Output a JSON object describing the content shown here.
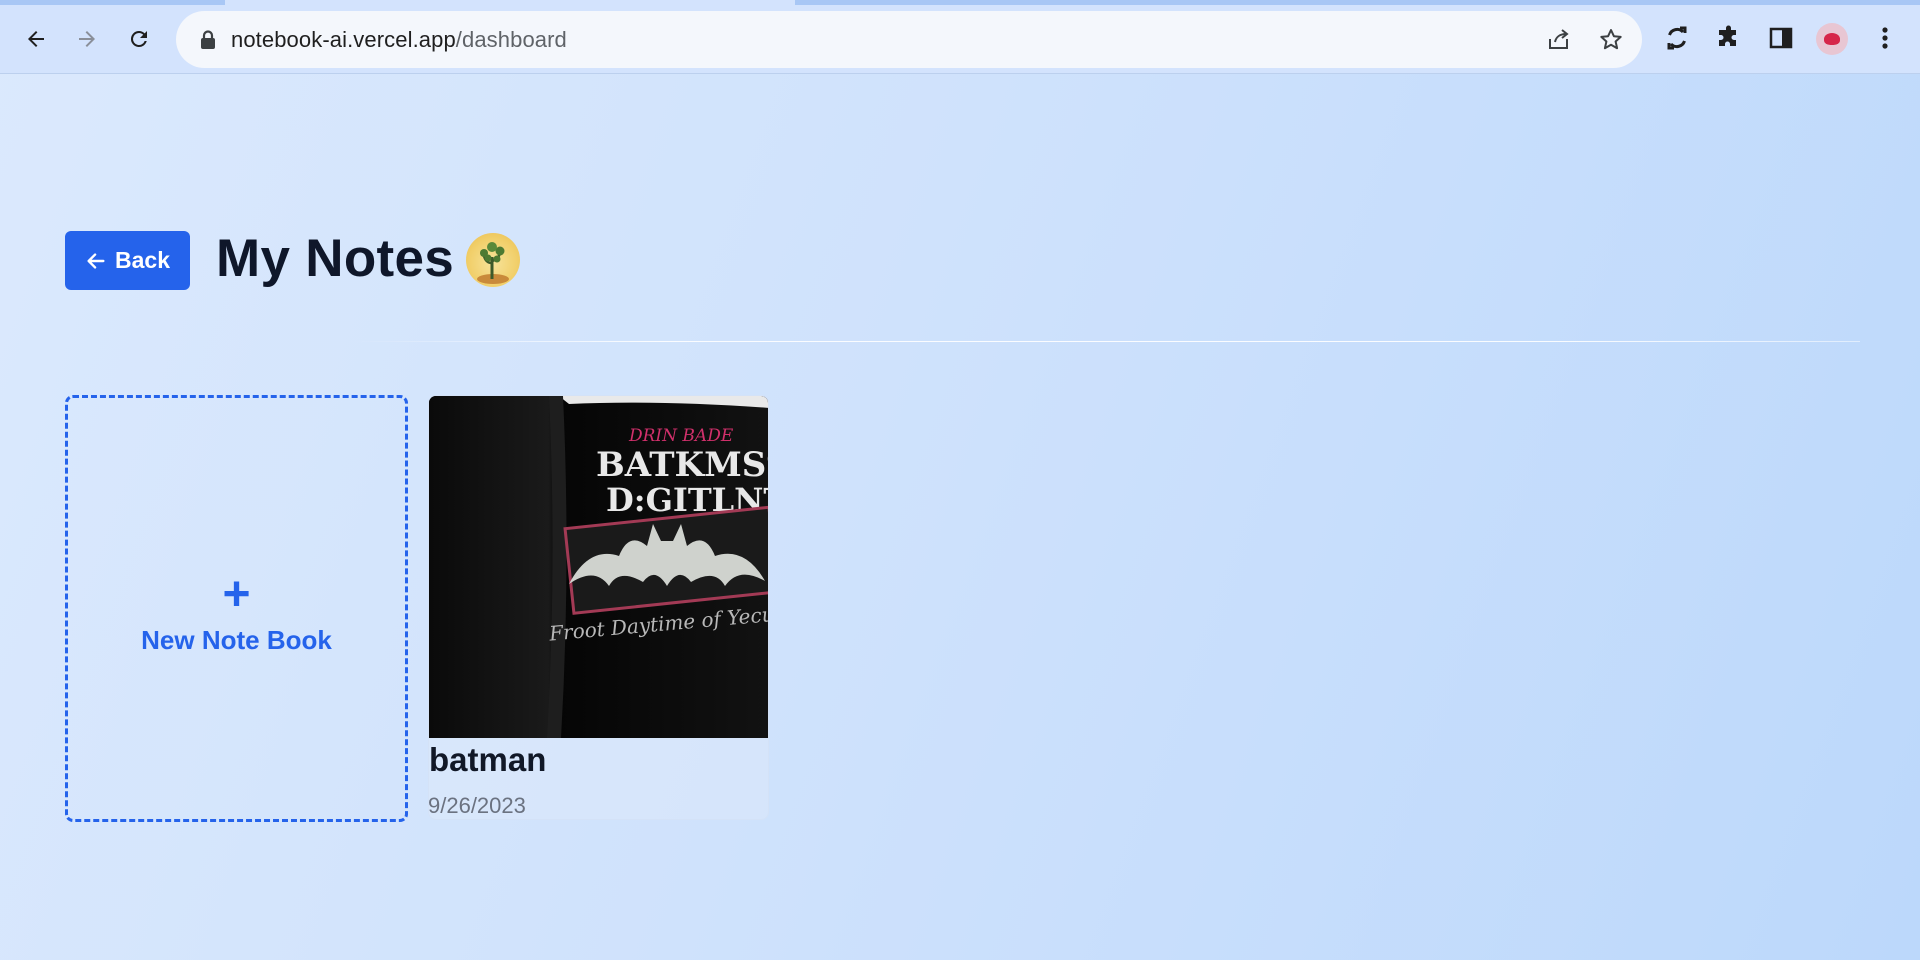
{
  "browser": {
    "url_host": "notebook-ai.vercel.app",
    "url_path": "/dashboard",
    "icons": [
      "back-arrow-icon",
      "forward-arrow-icon",
      "reload-icon",
      "lock-icon",
      "share-icon",
      "star-icon",
      "sync-icon",
      "extensions-icon",
      "side-panel-icon",
      "profile-avatar",
      "more-menu-icon"
    ]
  },
  "header": {
    "back_label": "Back",
    "title": "My Notes"
  },
  "new_notebook": {
    "icon": "+",
    "label": "New Note Book"
  },
  "notes": [
    {
      "title": "batman",
      "date": "9/26/2023",
      "thumbnail_text": {
        "line1": "DRIN BADE",
        "line2": "BATKMSS",
        "line3": "D:GITLNT",
        "line4": "Froot Daytime of Yecul"
      }
    }
  ],
  "colors": {
    "accent": "#2563eb",
    "title": "#0f172a",
    "muted": "#6b7280"
  }
}
